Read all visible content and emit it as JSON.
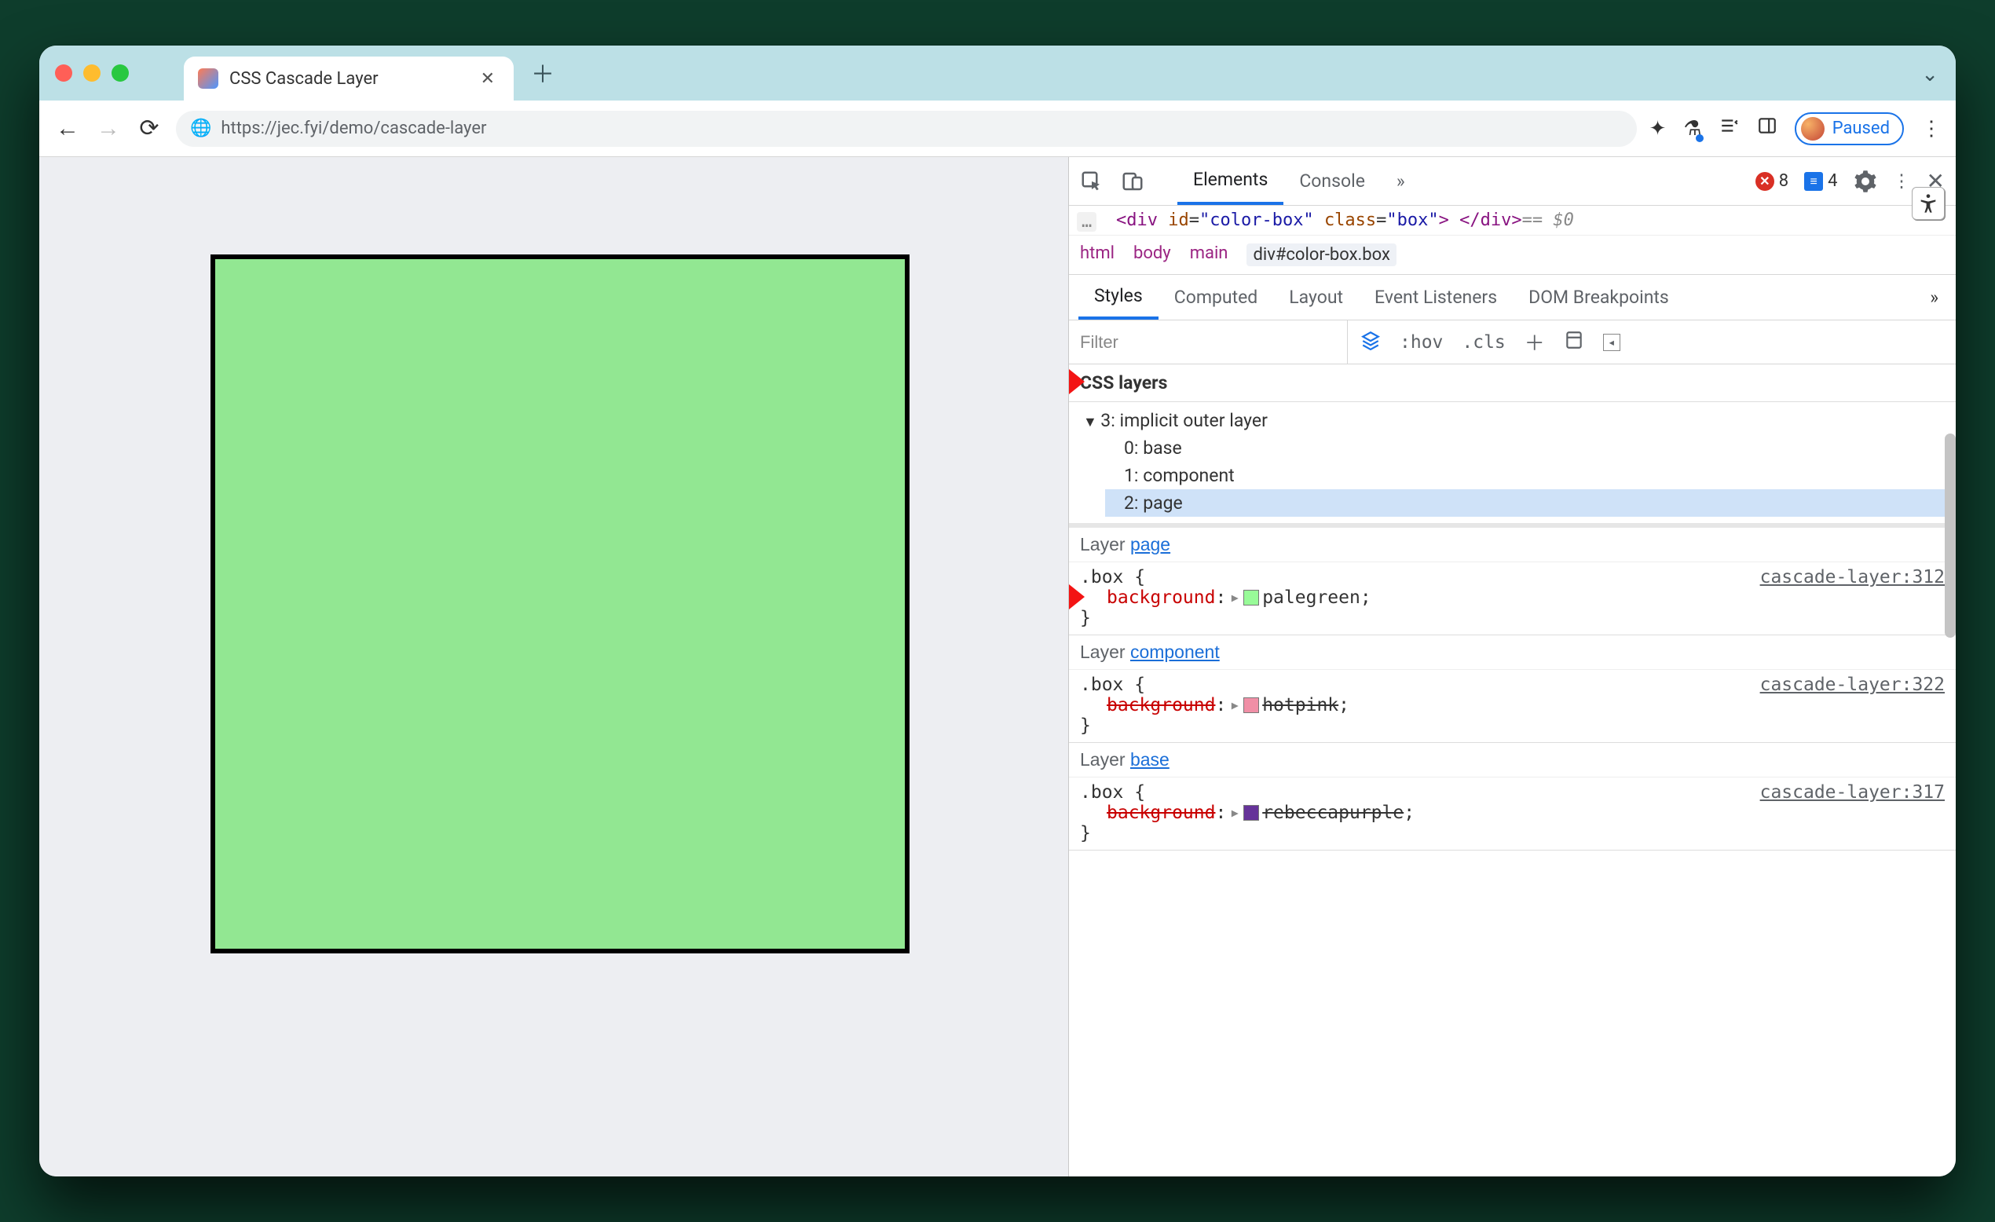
{
  "tab": {
    "title": "CSS Cascade Layer"
  },
  "url": "https://jec.fyi/demo/cascade-layer",
  "paused_label": "Paused",
  "devtools": {
    "tabs": [
      "Elements",
      "Console"
    ],
    "active_tab": "Elements",
    "error_count": "8",
    "msg_count": "4",
    "dom_line": {
      "open": "<div",
      "id_attr": "id",
      "id_val": "\"color-box\"",
      "class_attr": "class",
      "class_val": "\"box\"",
      "close": "> </div>",
      "trailer": " == $0"
    },
    "crumbs": [
      "html",
      "body",
      "main",
      "div#color-box.box"
    ],
    "styles_tabs": [
      "Styles",
      "Computed",
      "Layout",
      "Event Listeners",
      "DOM Breakpoints"
    ],
    "active_styles_tab": "Styles",
    "filter_placeholder": "Filter",
    "hov": ":hov",
    "cls": ".cls",
    "layers_title": "CSS layers",
    "layer_tree": {
      "root": "3: implicit outer layer",
      "items": [
        {
          "label": "0: base"
        },
        {
          "label": "1: component"
        },
        {
          "label": "2: page",
          "selected": true
        }
      ]
    },
    "rules": [
      {
        "layer_prefix": "Layer ",
        "layer": "page",
        "selector": ".box {",
        "source": "cascade-layer:312",
        "prop": "background",
        "value": "palegreen",
        "swatch": "sw-palegreen",
        "struck": false,
        "close": "}"
      },
      {
        "layer_prefix": "Layer ",
        "layer": "component",
        "selector": ".box {",
        "source": "cascade-layer:322",
        "prop": "background",
        "value": "hotpink",
        "swatch": "sw-hotpink",
        "struck": true,
        "close": "}"
      },
      {
        "layer_prefix": "Layer ",
        "layer": "base",
        "selector": ".box {",
        "source": "cascade-layer:317",
        "prop": "background",
        "value": "rebeccapurple",
        "swatch": "sw-rebecca",
        "struck": true,
        "close": "}"
      }
    ]
  }
}
